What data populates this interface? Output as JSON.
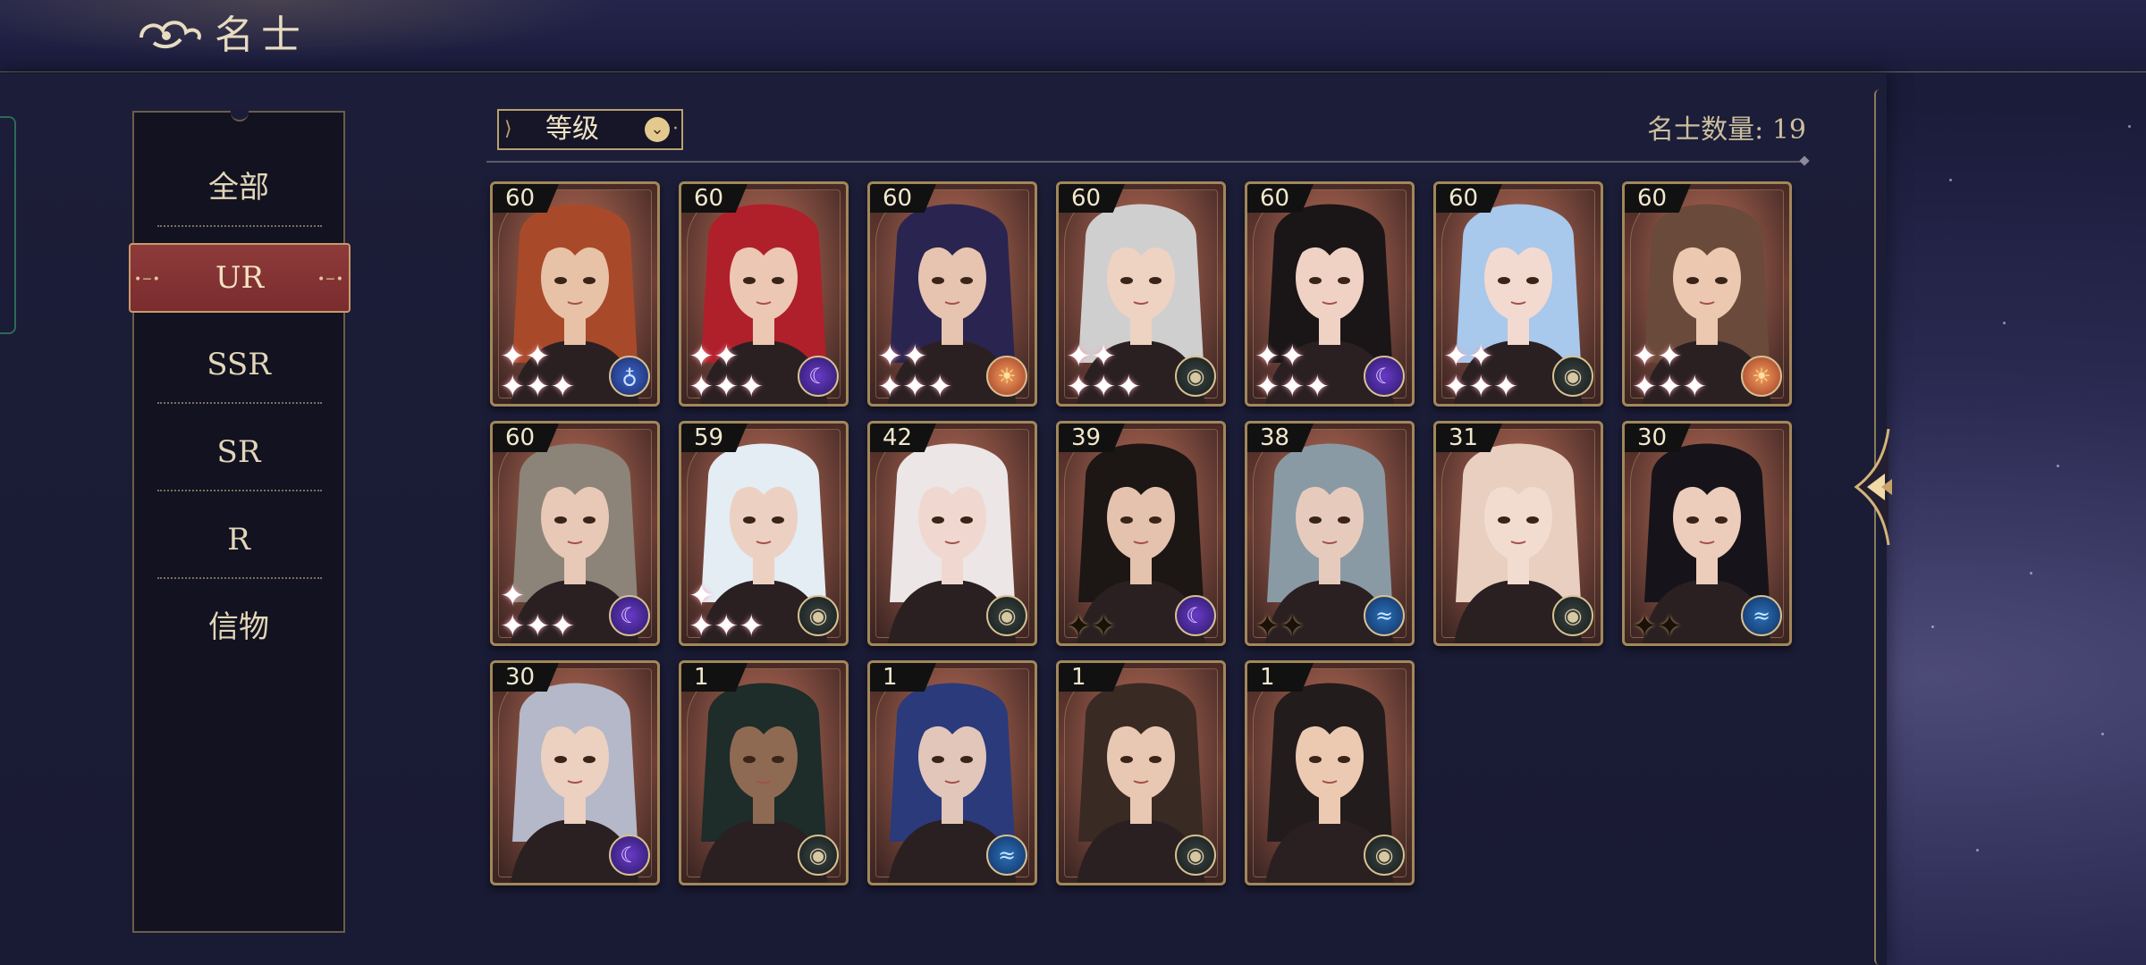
{
  "header": {
    "title": "名士"
  },
  "sidebar": {
    "items": [
      {
        "label": "全部"
      },
      {
        "label": "UR"
      },
      {
        "label": "SSR"
      },
      {
        "label": "SR"
      },
      {
        "label": "R"
      },
      {
        "label": "信物"
      }
    ],
    "selected": "UR"
  },
  "sort": {
    "label": "等级"
  },
  "count": {
    "label": "名士数量: 19",
    "value": 19
  },
  "characters": [
    {
      "level": "60",
      "stars": 5,
      "element": "planet-icon",
      "hair": "#a84a2a",
      "skin": "#e8c2a6"
    },
    {
      "level": "60",
      "stars": 5,
      "element": "moon-icon",
      "hair": "#b0202a",
      "skin": "#ecc8b4"
    },
    {
      "level": "60",
      "stars": 5,
      "element": "sun-icon",
      "hair": "#2a2450",
      "skin": "#e6c4b0"
    },
    {
      "level": "60",
      "stars": 5,
      "element": "eye-icon",
      "hair": "#cfcfcf",
      "skin": "#eed2c2"
    },
    {
      "level": "60",
      "stars": 5,
      "element": "moon-icon",
      "hair": "#1a1618",
      "skin": "#f0d2c4"
    },
    {
      "level": "60",
      "stars": 5,
      "element": "eye-icon",
      "hair": "#a8c8ec",
      "skin": "#f2dad0"
    },
    {
      "level": "60",
      "stars": 5,
      "element": "sun-icon",
      "hair": "#6a4a3a",
      "skin": "#ecc8b0"
    },
    {
      "level": "60",
      "stars": 4,
      "element": "moon-icon",
      "hair": "#8c8478",
      "skin": "#e8c8b6"
    },
    {
      "level": "59",
      "stars": 4,
      "element": "eye-icon",
      "hair": "#e4ecf4",
      "skin": "#ecd0c2"
    },
    {
      "level": "42",
      "stars": 0,
      "element": "eye-icon",
      "hair": "#ece6e6",
      "skin": "#f0d8d0"
    },
    {
      "level": "39",
      "stars": 2,
      "element": "moon-icon",
      "hair": "#1c1614",
      "skin": "#e4c2ae"
    },
    {
      "level": "38",
      "stars": 2,
      "element": "wave-icon",
      "hair": "#8a9aa4",
      "skin": "#e6cbbc"
    },
    {
      "level": "31",
      "stars": 0,
      "element": "eye-icon",
      "hair": "#e8cfc0",
      "skin": "#f2dcd0"
    },
    {
      "level": "30",
      "stars": 2,
      "element": "wave-icon",
      "hair": "#16141a",
      "skin": "#ecccba"
    },
    {
      "level": "30",
      "stars": 0,
      "element": "moon-icon",
      "hair": "#b4b8c8",
      "skin": "#ecd0c0"
    },
    {
      "level": "1",
      "stars": 0,
      "element": "eye-icon",
      "hair": "#1e2c2a",
      "skin": "#8e6a52"
    },
    {
      "level": "1",
      "stars": 0,
      "element": "wave-icon",
      "hair": "#2a3a7a",
      "skin": "#e2c6ba"
    },
    {
      "level": "1",
      "stars": 0,
      "element": "eye-icon",
      "hair": "#3a2a24",
      "skin": "#e8c8b2"
    },
    {
      "level": "1",
      "stars": 0,
      "element": "eye-icon",
      "hair": "#231c1c",
      "skin": "#eccab2"
    }
  ],
  "colors": {
    "accent_gold": "#b9a06e",
    "selected_red": "#8e3a3a",
    "text_cream": "#e2d6b8"
  }
}
